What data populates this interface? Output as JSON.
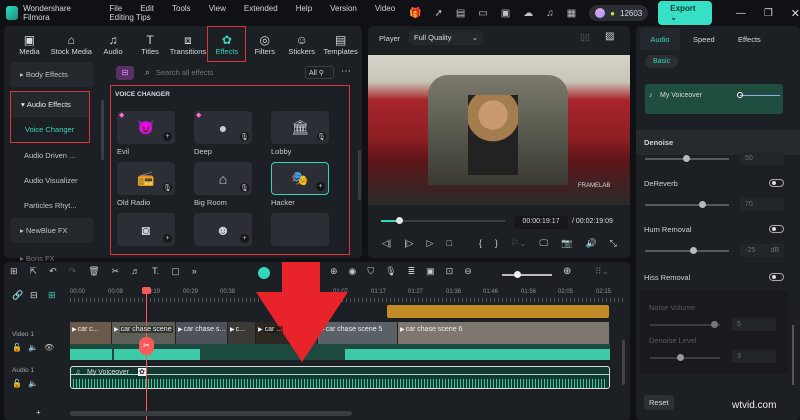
{
  "app": {
    "title": "Wondershare Filmora",
    "menu": [
      "File",
      "Edit",
      "Tools",
      "View",
      "Extended",
      "Help",
      "Version",
      "Video Editing Tips"
    ],
    "credits": "12603",
    "export": "Export",
    "accent": "#34d6b8",
    "highlight": "#d8343a"
  },
  "categories": [
    {
      "label": "Media",
      "icon": "media-icon"
    },
    {
      "label": "Stock Media",
      "icon": "stock-icon"
    },
    {
      "label": "Audio",
      "icon": "music-icon"
    },
    {
      "label": "Titles",
      "icon": "title-icon"
    },
    {
      "label": "Transitions",
      "icon": "transition-icon"
    },
    {
      "label": "Effects",
      "icon": "effects-icon",
      "active": true
    },
    {
      "label": "Filters",
      "icon": "filter-icon"
    },
    {
      "label": "Stickers",
      "icon": "sticker-icon"
    },
    {
      "label": "Templates",
      "icon": "template-icon"
    }
  ],
  "sidebar": {
    "items": [
      "Body Effects",
      "Audio Effects",
      "Voice Changer",
      "Audio Driven ...",
      "Audio Visualizer",
      "Particles Rhyt...",
      "NewBlue FX",
      "Boris FX"
    ]
  },
  "effects": {
    "search_placeholder": "Search all effects",
    "filter": "All",
    "section": "VOICE CHANGER",
    "items": [
      "Evil",
      "Deep",
      "Lobby",
      "Old Radio",
      "Big Room",
      "Hacker"
    ]
  },
  "player": {
    "label": "Player",
    "quality": "Full Quality",
    "current": "00:00:19:17",
    "total": "/ 00:02:19:09",
    "progress": 0.14,
    "watermark": "FRAMELAB"
  },
  "right": {
    "tabs": [
      "Audio",
      "Speed",
      "Effects"
    ],
    "basic": "Basic",
    "clip": "My Voiceover",
    "denoise": "Denoise",
    "denoise_val": "50",
    "dereverb": "DeReverb",
    "dereverb_val": "70",
    "hum": "Hum Removal",
    "hum_val": "-25",
    "hum_unit": "dB",
    "hiss": "Hiss Removal",
    "noise_volume": "Noise Volume",
    "noise_volume_val": "5",
    "denoise_level": "Denoise Level",
    "denoise_level_val": "3",
    "reset": "Reset"
  },
  "timeline": {
    "ticks": [
      "00:00",
      "00:09",
      "00:19",
      "00:29",
      "00:38",
      "01:07",
      "01:17",
      "01:27",
      "01:36",
      "01:46",
      "01:56",
      "02:05",
      "02:15"
    ],
    "video_track": "Video 1",
    "audio_track": "Audio 1",
    "clips": [
      "car c...",
      "car chase scene",
      "car chase s...",
      "c...",
      "car ...",
      "",
      "car chase scene 5",
      "car chase scene 6"
    ],
    "audio_clip": "My Voiceover"
  },
  "watermark": "wtvid.com"
}
